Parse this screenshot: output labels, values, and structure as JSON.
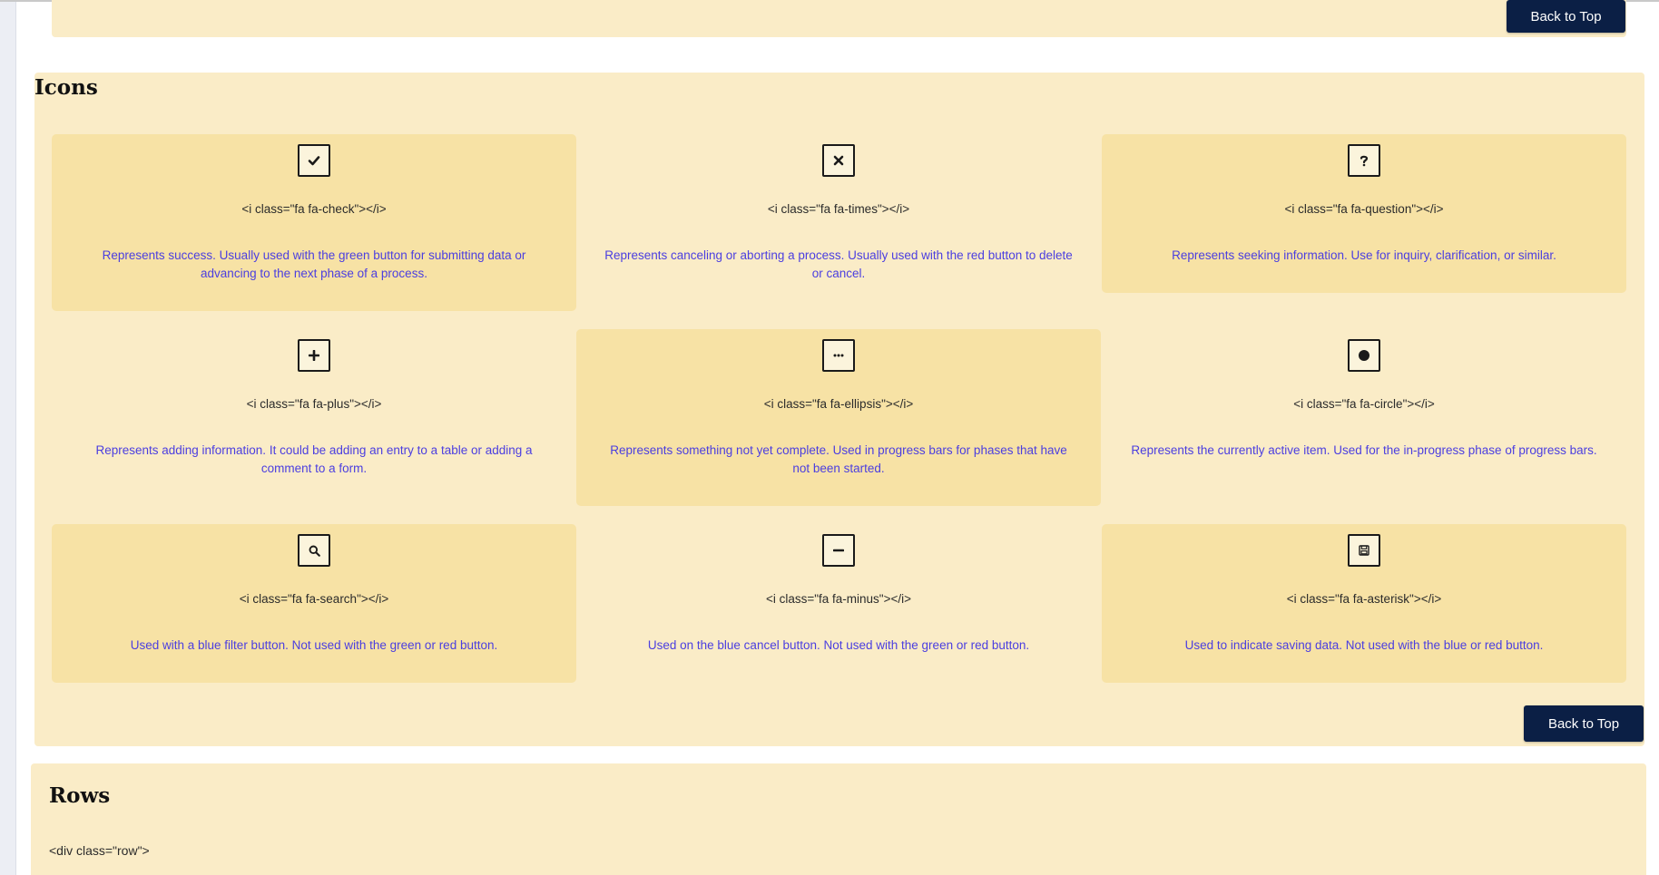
{
  "nav": {
    "back_to_top": "Back to Top"
  },
  "icons_section": {
    "title": "Icons",
    "cards": [
      {
        "icon": "check-icon",
        "code": "<i class=\"fa fa-check\"></i>",
        "description": "Represents success. Usually used with the green button for submitting data or advancing to the next phase of a process."
      },
      {
        "icon": "times-icon",
        "code": "<i class=\"fa fa-times\"></i>",
        "description": "Represents canceling or aborting a process. Usually used with the red button to delete or cancel."
      },
      {
        "icon": "question-icon",
        "code": "<i class=\"fa fa-question\"></i>",
        "description": "Represents seeking information. Use for inquiry, clarification, or similar."
      },
      {
        "icon": "plus-icon",
        "code": "<i class=\"fa fa-plus\"></i>",
        "description": "Represents adding information. It could be adding an entry to a table or adding a comment to a form."
      },
      {
        "icon": "ellipsis-icon",
        "code": "<i class=\"fa fa-ellipsis\"></i>",
        "description": "Represents something not yet complete. Used in progress bars for phases that have not been started."
      },
      {
        "icon": "circle-icon",
        "code": "<i class=\"fa fa-circle\"></i>",
        "description": "Represents the currently active item. Used for the in-progress phase of progress bars."
      },
      {
        "icon": "search-icon",
        "code": "<i class=\"fa fa-search\"></i>",
        "description": "Used with a blue filter button. Not used with the green or red button."
      },
      {
        "icon": "minus-icon",
        "code": "<i class=\"fa fa-minus\"></i>",
        "description": "Used on the blue cancel button. Not used with the green or red button."
      },
      {
        "icon": "save-icon",
        "code": "<i class=\"fa fa-asterisk\"></i>",
        "description": "Used to indicate saving data. Not used with the blue or red button."
      }
    ]
  },
  "rows_section": {
    "title": "Rows",
    "code": "<div class=\"row\">"
  },
  "colors": {
    "section_background": "#faecc7",
    "card_highlight": "#f7e2a5",
    "button_navy": "#0b1f45",
    "description_text": "#4b3ee0"
  }
}
